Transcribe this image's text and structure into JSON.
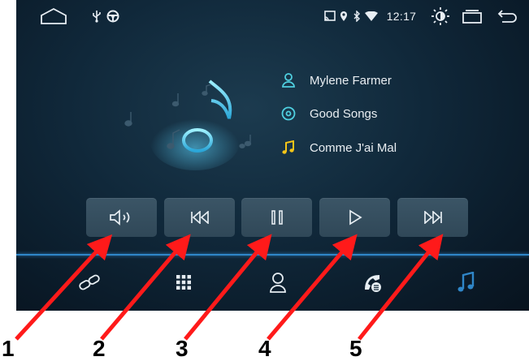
{
  "status_bar": {
    "time": "12:17",
    "icons": [
      "home-icon",
      "usb-icon",
      "steering-wheel-icon",
      "cast-icon",
      "location-icon",
      "bluetooth-icon",
      "wifi-icon",
      "brightness-icon",
      "recent-apps-icon",
      "back-icon"
    ]
  },
  "track": {
    "artist": "Mylene Farmer",
    "album": "Good Songs",
    "title": "Comme J'ai Mal"
  },
  "controls": [
    "volume-icon",
    "previous-icon",
    "pause-icon",
    "play-icon",
    "next-icon"
  ],
  "nav": [
    "link-icon",
    "apps-grid-icon",
    "contacts-icon",
    "phone-music-icon",
    "music-note-icon"
  ],
  "colors": {
    "accent": "#2f86c8",
    "arrow": "#ff1a1a",
    "button": "#3b5566"
  },
  "callouts": [
    "1",
    "2",
    "3",
    "4",
    "5"
  ]
}
